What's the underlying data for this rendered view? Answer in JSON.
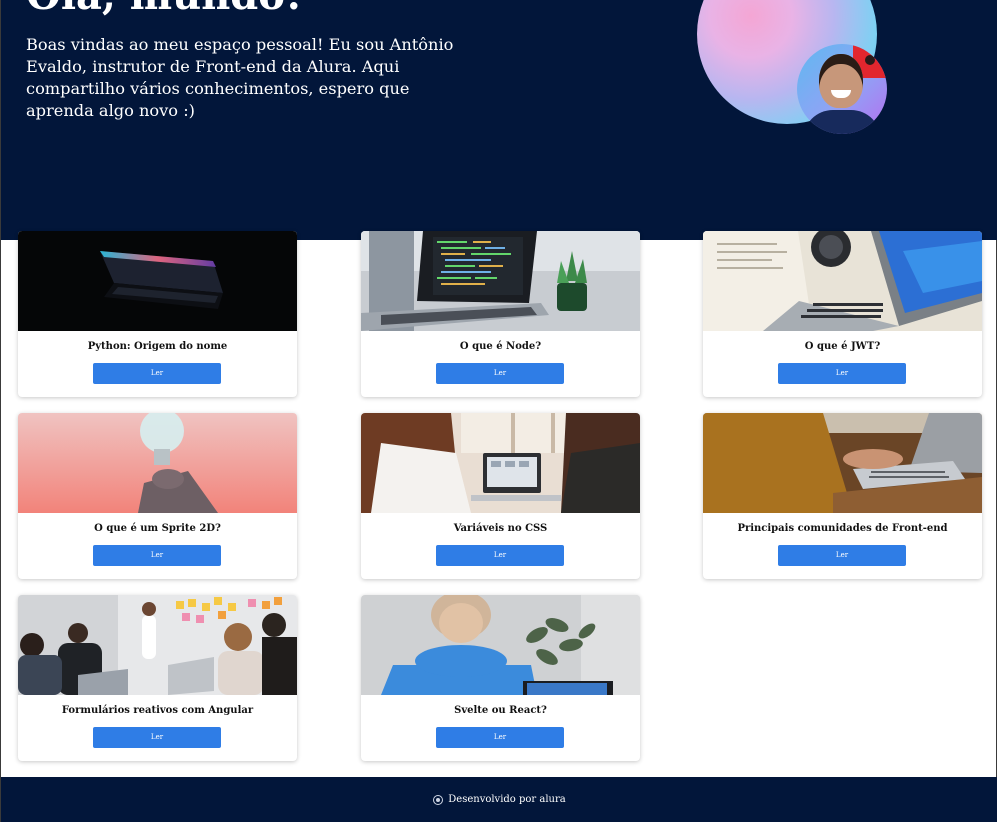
{
  "hero": {
    "title": "Olá, mundo!",
    "text": "Boas vindas ao meu espaço pessoal! Eu sou Antônio Evaldo, instrutor de Front-end da Alura. Aqui compartilho vários conhecimentos, espero que aprenda algo novo :)"
  },
  "cards": [
    {
      "title": "Python: Origem do nome",
      "button": "Ler"
    },
    {
      "title": "O que é Node?",
      "button": "Ler"
    },
    {
      "title": "O que é JWT?",
      "button": "Ler"
    },
    {
      "title": "O que é um Sprite 2D?",
      "button": "Ler"
    },
    {
      "title": "Variáveis no CSS",
      "button": "Ler"
    },
    {
      "title": "Principais comunidades de Front-end",
      "button": "Ler"
    },
    {
      "title": "Formulários reativos com Angular",
      "button": "Ler"
    },
    {
      "title": "Svelte ou React?",
      "button": "Ler"
    }
  ],
  "footer": {
    "text": "Desenvolvido por alura",
    "icon": "alura-logo-icon"
  },
  "colors": {
    "header_bg": "#02163a",
    "button": "#2f7de6"
  }
}
